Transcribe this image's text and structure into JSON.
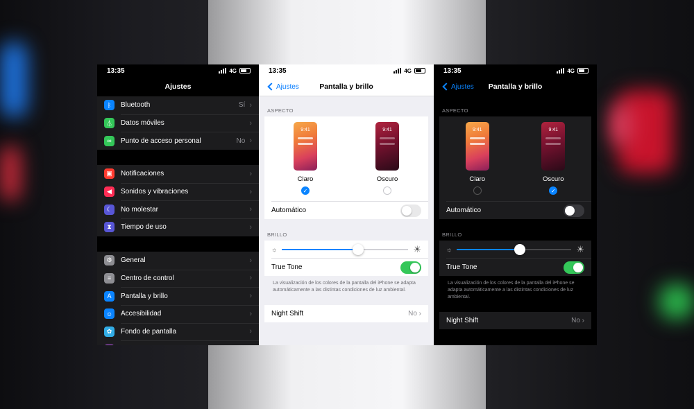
{
  "status": {
    "time": "13:35",
    "network": "4G"
  },
  "settings": {
    "title": "Ajustes",
    "groups": [
      [
        {
          "label": "Bluetooth",
          "value": "Sí",
          "icon": "bluetooth-icon",
          "color": "#0a84ff"
        },
        {
          "label": "Datos móviles",
          "value": "",
          "icon": "antenna-icon",
          "color": "#34c759"
        },
        {
          "label": "Punto de acceso personal",
          "value": "No",
          "icon": "hotspot-icon",
          "color": "#34c759"
        }
      ],
      [
        {
          "label": "Notificaciones",
          "value": "",
          "icon": "notifications-icon",
          "color": "#ff3b30"
        },
        {
          "label": "Sonidos y vibraciones",
          "value": "",
          "icon": "speaker-icon",
          "color": "#ff2d55"
        },
        {
          "label": "No molestar",
          "value": "",
          "icon": "moon-icon",
          "color": "#5856d6"
        },
        {
          "label": "Tiempo de uso",
          "value": "",
          "icon": "hourglass-icon",
          "color": "#5856d6"
        }
      ],
      [
        {
          "label": "General",
          "value": "",
          "icon": "gear-icon",
          "color": "#8e8e93"
        },
        {
          "label": "Centro de control",
          "value": "",
          "icon": "switches-icon",
          "color": "#8e8e93"
        },
        {
          "label": "Pantalla y brillo",
          "value": "",
          "icon": "text-size-icon",
          "color": "#0a84ff"
        },
        {
          "label": "Accesibilidad",
          "value": "",
          "icon": "accessibility-icon",
          "color": "#0a84ff"
        },
        {
          "label": "Fondo de pantalla",
          "value": "",
          "icon": "flower-icon",
          "color": "#32ade6"
        },
        {
          "label": "Siri y Buscar",
          "value": "",
          "icon": "siri-icon",
          "color": "#bf5af2"
        }
      ]
    ]
  },
  "display": {
    "back_label": "Ajustes",
    "title": "Pantalla y brillo",
    "appearance_header": "ASPECTO",
    "thumb_time": "9:41",
    "light_label": "Claro",
    "dark_label": "Oscuro",
    "automatic_label": "Automático",
    "brightness_header": "BRILLO",
    "true_tone_label": "True Tone",
    "true_tone_footer": "La visualización de los colores de la pantalla del iPhone se adapta automáticamente a las distintas condiciones de luz ambiental.",
    "night_shift_label": "Night Shift",
    "night_shift_value": "No"
  },
  "light_screen": {
    "selected": "light",
    "automatic": false,
    "brightness": 0.6,
    "true_tone": true
  },
  "dark_screen": {
    "selected": "dark",
    "automatic": false,
    "brightness": 0.55,
    "true_tone": true
  }
}
